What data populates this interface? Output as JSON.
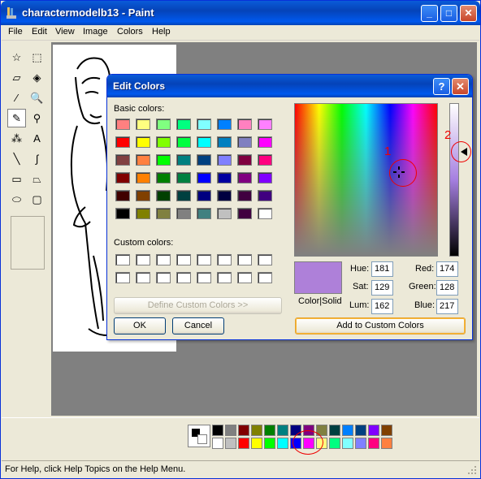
{
  "window": {
    "title": "charactermodelb13 - Paint",
    "minimize": "_",
    "maximize": "□",
    "close": "✕"
  },
  "menu": [
    "File",
    "Edit",
    "View",
    "Image",
    "Colors",
    "Help"
  ],
  "tools": [
    {
      "icon": "free-select-icon",
      "glyph": "☆"
    },
    {
      "icon": "rect-select-icon",
      "glyph": "⬚"
    },
    {
      "icon": "eraser-icon",
      "glyph": "▱"
    },
    {
      "icon": "fill-bucket-icon",
      "glyph": "◈"
    },
    {
      "icon": "color-picker-icon",
      "glyph": "⁄"
    },
    {
      "icon": "magnifier-icon",
      "glyph": "🔍"
    },
    {
      "icon": "pencil-icon",
      "glyph": "✎"
    },
    {
      "icon": "brush-icon",
      "glyph": "⚲"
    },
    {
      "icon": "airbrush-icon",
      "glyph": "⁂"
    },
    {
      "icon": "text-icon",
      "glyph": "A"
    },
    {
      "icon": "line-icon",
      "glyph": "╲"
    },
    {
      "icon": "curve-icon",
      "glyph": "∫"
    },
    {
      "icon": "rectangle-icon",
      "glyph": "▭"
    },
    {
      "icon": "polygon-icon",
      "glyph": "⏢"
    },
    {
      "icon": "ellipse-icon",
      "glyph": "⬭"
    },
    {
      "icon": "rounded-rect-icon",
      "glyph": "▢"
    }
  ],
  "dialog": {
    "title": "Edit Colors",
    "help": "?",
    "close": "✕",
    "basic_label": "Basic colors:",
    "custom_label": "Custom colors:",
    "define_button": "Define Custom Colors >>",
    "ok": "OK",
    "cancel": "Cancel",
    "color_solid": "Color|Solid",
    "add_button": "Add to Custom Colors",
    "hue_label": "Hue:",
    "sat_label": "Sat:",
    "lum_label": "Lum:",
    "red_label": "Red:",
    "green_label": "Green:",
    "blue_label": "Blue:",
    "hue": "181",
    "sat": "129",
    "lum": "162",
    "red": "174",
    "green": "128",
    "blue": "217",
    "preview_color": "#ae80d9",
    "basic_colors": [
      "#ff8080",
      "#ffff80",
      "#80ff80",
      "#00ff80",
      "#80ffff",
      "#0080ff",
      "#ff80c0",
      "#ff80ff",
      "#ff0000",
      "#ffff00",
      "#80ff00",
      "#00ff40",
      "#00ffff",
      "#0080c0",
      "#8080c0",
      "#ff00ff",
      "#804040",
      "#ff8040",
      "#00ff00",
      "#008080",
      "#004080",
      "#8080ff",
      "#800040",
      "#ff0080",
      "#800000",
      "#ff8000",
      "#008000",
      "#008040",
      "#0000ff",
      "#0000a0",
      "#800080",
      "#8000ff",
      "#400000",
      "#804000",
      "#004000",
      "#004040",
      "#000080",
      "#000040",
      "#400040",
      "#400080",
      "#000000",
      "#808000",
      "#808040",
      "#808080",
      "#408080",
      "#c0c0c0",
      "#400040",
      "#ffffff"
    ]
  },
  "palette": {
    "top": [
      "#000000",
      "#808080",
      "#800000",
      "#808000",
      "#008000",
      "#008080",
      "#000080",
      "#800080",
      "#808040",
      "#004040",
      "#0080ff",
      "#004080",
      "#8000ff",
      "#804000"
    ],
    "bottom": [
      "#ffffff",
      "#c0c0c0",
      "#ff0000",
      "#ffff00",
      "#00ff00",
      "#00ffff",
      "#0000ff",
      "#ff00ff",
      "#ffff80",
      "#00ff80",
      "#80ffff",
      "#8080ff",
      "#ff0080",
      "#ff8040"
    ]
  },
  "annotations": {
    "one": "1",
    "two": "2"
  },
  "status": "For Help, click Help Topics on the Help Menu."
}
